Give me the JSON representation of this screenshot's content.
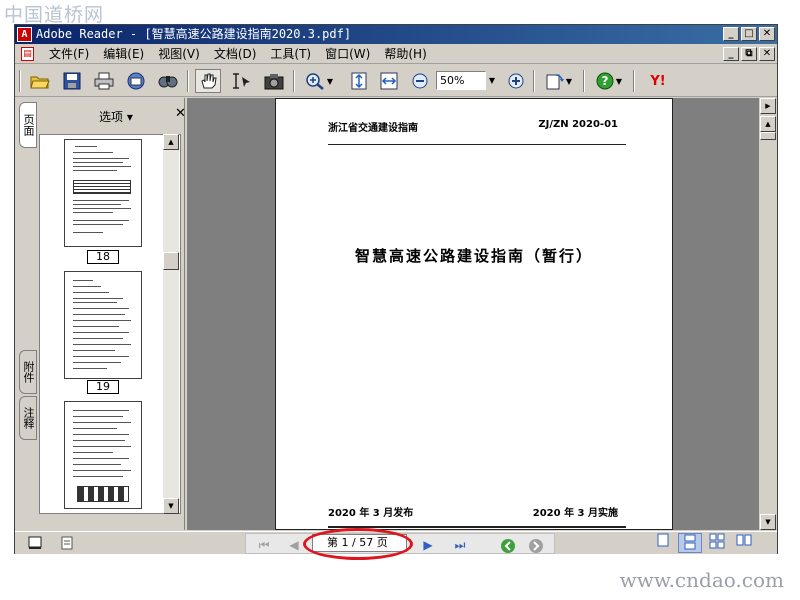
{
  "watermark": {
    "top": "中国道桥网",
    "bottom": "www.cndao.com"
  },
  "window": {
    "title": "Adobe Reader - [智慧高速公路建设指南2020.3.pdf]",
    "app_icon_letter": "A",
    "buttons": {
      "minimize": "_",
      "maximize": "□",
      "close": "✕"
    }
  },
  "menubar": {
    "items": [
      "文件(F)",
      "编辑(E)",
      "视图(V)",
      "文档(D)",
      "工具(T)",
      "窗口(W)",
      "帮助(H)"
    ],
    "mdi_buttons": {
      "minimize": "_",
      "restore": "⧉",
      "close": "✕"
    }
  },
  "toolbar": {
    "icons": [
      "open-icon",
      "save-icon",
      "print-icon",
      "email-icon",
      "search-icon",
      "hand-icon",
      "select-text-icon",
      "snapshot-icon",
      "zoom-in-tool-icon",
      "actual-size-icon",
      "fit-width-icon",
      "zoom-out-icon",
      "zoom-plus-icon",
      "rotate-icon",
      "help-icon",
      "yahoo-icon"
    ],
    "zoom_value": "50%",
    "yahoo_label": "Y!"
  },
  "sidebar": {
    "tabs": [
      "页面",
      "附件",
      "注释"
    ],
    "options_label": "选项 ▾",
    "close_label": "✕",
    "thumbnails": [
      {
        "label": "18"
      },
      {
        "label": "19"
      },
      {
        "label": ""
      }
    ]
  },
  "document": {
    "header_left": "浙江省交通建设指南",
    "header_right": "ZJ/ZN 2020-01",
    "title": "智慧高速公路建设指南（暂行）",
    "footer_left": "2020 年 3 月发布",
    "footer_right": "2020 年 3 月实施"
  },
  "statusbar": {
    "page_indicator": "第 1 / 57 页",
    "annotation_color": "#e0141e"
  },
  "colors": {
    "titlebar_start": "#0a246a",
    "titlebar_end": "#3a6ea5",
    "chrome": "#d4d0c8",
    "viewer_bg": "#7f7f7f"
  }
}
